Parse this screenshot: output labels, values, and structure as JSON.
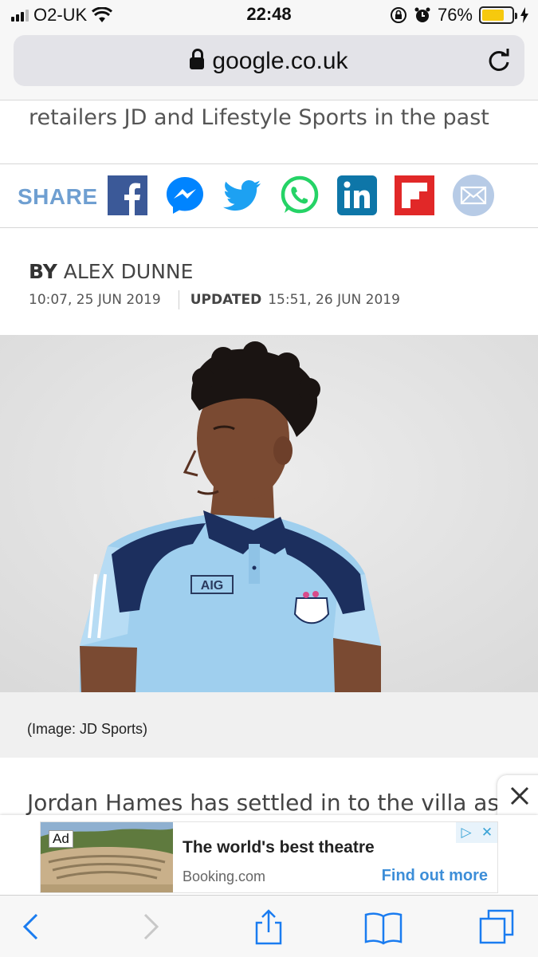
{
  "status_bar": {
    "carrier": "O2-UK",
    "time": "22:48",
    "battery_percent": "76%",
    "battery_level": 0.76,
    "battery_color": "#f6c90e"
  },
  "url_bar": {
    "domain": "google.co.uk",
    "lock_icon": "lock-icon",
    "reload_icon": "reload-icon"
  },
  "article": {
    "snippet": "retailers JD and Lifestyle Sports in the past",
    "share_label": "SHARE",
    "share_buttons": [
      {
        "name": "facebook",
        "icon": "facebook-icon",
        "color": "#3b5998"
      },
      {
        "name": "messenger",
        "icon": "messenger-icon",
        "color": "#0084ff"
      },
      {
        "name": "twitter",
        "icon": "twitter-icon",
        "color": "#1da1f2"
      },
      {
        "name": "whatsapp",
        "icon": "whatsapp-icon",
        "color": "#25d366"
      },
      {
        "name": "linkedin",
        "icon": "linkedin-icon",
        "color": "#0e76a8"
      },
      {
        "name": "flipboard",
        "icon": "flipboard-icon",
        "color": "#e12828"
      },
      {
        "name": "email",
        "icon": "email-icon",
        "color": "#b7cbe6"
      }
    ],
    "byline_prefix": "BY",
    "author": "ALEX DUNNE",
    "published": "10:07, 25 JUN 2019",
    "updated_label": "UPDATED",
    "updated": "15:51, 26 JUN 2019",
    "photo_caption": "(Image: JD Sports)",
    "paragraph_start": "Jordan Hames has settled in to the villa as a"
  },
  "ad": {
    "tag": "Ad",
    "title": "The world's best theatre",
    "source": "Booking.com",
    "cta": "Find out more",
    "close_icon": "close-icon"
  },
  "toolbar": {
    "back_icon": "back-icon",
    "forward_icon": "forward-icon",
    "share_icon": "share-icon",
    "bookmarks_icon": "bookmarks-icon",
    "tabs_icon": "tabs-icon"
  }
}
